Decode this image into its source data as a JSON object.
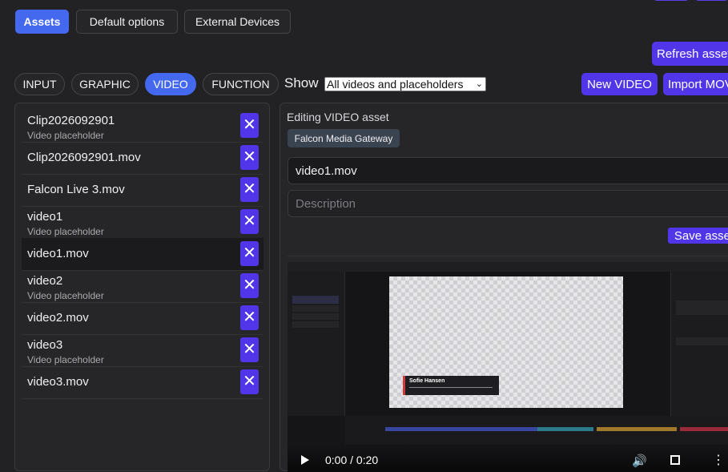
{
  "top_tabs": [
    {
      "label": "Assets",
      "active": true
    },
    {
      "label": "Default options",
      "active": false
    },
    {
      "label": "External Devices",
      "active": false
    }
  ],
  "refresh_label": "Refresh assets",
  "type_tabs": [
    {
      "label": "INPUT",
      "active": false
    },
    {
      "label": "GRAPHIC",
      "active": false
    },
    {
      "label": "VIDEO",
      "active": true
    },
    {
      "label": "FUNCTION",
      "active": false
    }
  ],
  "show_label": "Show",
  "show_select": {
    "selected": "All videos and placeholders"
  },
  "new_video_label": "New VIDEO",
  "import_label": "Import MOV",
  "assets": [
    {
      "title": "Clip2026092901",
      "subtitle": "Video placeholder",
      "selected": false
    },
    {
      "title": "Clip2026092901.mov",
      "subtitle": "",
      "selected": false
    },
    {
      "title": "Falcon Live 3.mov",
      "subtitle": "",
      "selected": false
    },
    {
      "title": "video1",
      "subtitle": "Video placeholder",
      "selected": false
    },
    {
      "title": "video1.mov",
      "subtitle": "",
      "selected": true
    },
    {
      "title": "video2",
      "subtitle": "Video placeholder",
      "selected": false
    },
    {
      "title": "video2.mov",
      "subtitle": "",
      "selected": false
    },
    {
      "title": "video3",
      "subtitle": "Video placeholder",
      "selected": false
    },
    {
      "title": "video3.mov",
      "subtitle": "",
      "selected": false
    }
  ],
  "remove_glyph": "✕",
  "editor": {
    "heading": "Editing VIDEO asset",
    "source_tag": "Falcon Media Gateway",
    "name_value": "video1.mov",
    "description_placeholder": "Description",
    "save_label": "Save asset"
  },
  "player": {
    "time": "0:00 / 0:20",
    "lower_third_name": "Sofie Hansen"
  }
}
